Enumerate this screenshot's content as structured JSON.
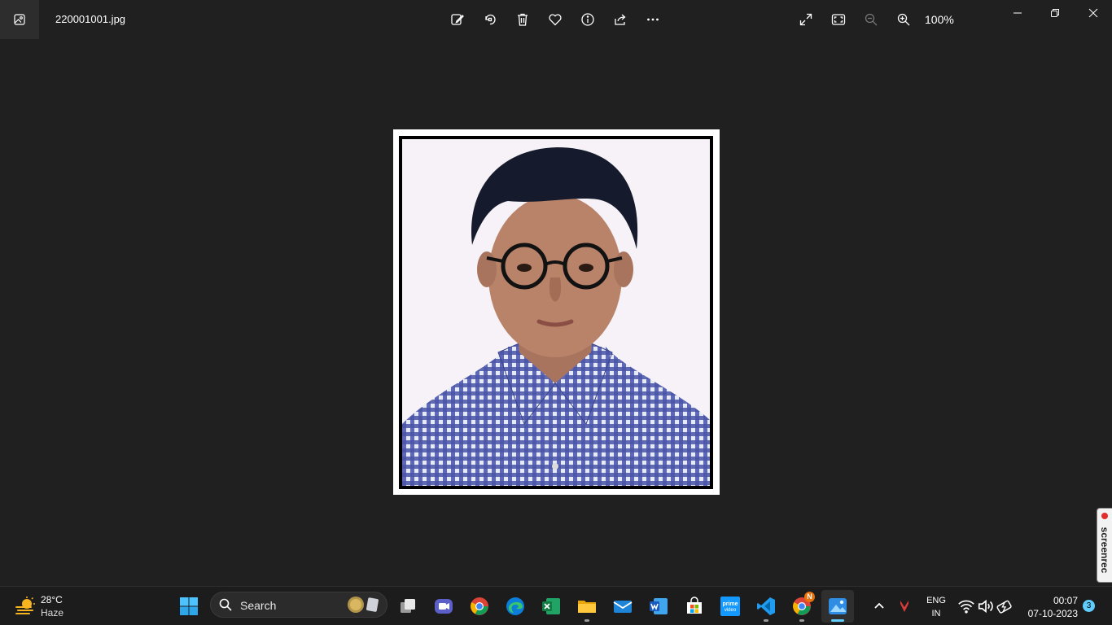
{
  "window": {
    "filename": "220001001.jpg",
    "zoom_level": "100%"
  },
  "toolbar": {
    "icons": [
      "edit-image-icon",
      "rotate-icon",
      "delete-icon",
      "favorite-icon",
      "info-icon",
      "share-icon",
      "more-icon"
    ],
    "right_icons": [
      "fullscreen-icon",
      "fit-to-window-icon",
      "zoom-out-icon",
      "zoom-in-icon"
    ]
  },
  "screenrec": {
    "label": "screenrec"
  },
  "taskbar": {
    "weather": {
      "temperature": "28°C",
      "condition": "Haze"
    },
    "search": {
      "label": "Search"
    },
    "apps": [
      "start",
      "task-view",
      "teams-meet",
      "chrome",
      "edge",
      "excel",
      "file-explorer",
      "mail",
      "word",
      "microsoft-store",
      "prime-video",
      "vs-code",
      "chrome-profile",
      "photos"
    ],
    "chrome_profile_badge": "N",
    "language": {
      "line1": "ENG",
      "line2": "IN"
    },
    "clock": {
      "time": "00:07",
      "date": "07-10-2023"
    },
    "notification_count": "3"
  },
  "colors": {
    "background": "#202020",
    "taskbar": "#1c1c1c",
    "accent": "#60cdff"
  }
}
